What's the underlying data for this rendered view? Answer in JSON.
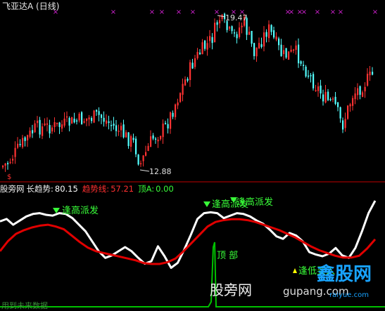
{
  "title": "飞亚达A (日线)",
  "price_chart": {
    "high_label": "19.47",
    "low_label": "12.88",
    "flag_label": "$"
  },
  "indicator_bar": {
    "source": "股旁网",
    "name": "长趋势:",
    "trend_value": "80.15",
    "trendline_label": "趋势线:",
    "trendline_value": "57.21",
    "top_label": "顶A:",
    "top_value": "0.00"
  },
  "annotations": {
    "sell_1": "逢高派发",
    "sell_2": "逢高派发",
    "sell_3": "逢高派发",
    "top": "顶 部",
    "buy": "逢低买入"
  },
  "watermarks": {
    "main": "股旁网",
    "url": "gupang.com",
    "logo": "鑫股网",
    "domain": "raiyue.com",
    "bottom": "用到未来数据"
  },
  "colors": {
    "background": "#000000",
    "up_candle": "#ff3232",
    "down_candle": "#54ffff",
    "divider": "#c00000",
    "long_trend": "#ffffff",
    "trend_line": "#e00000",
    "top_line": "#00c000",
    "signal_text": "#39ff39",
    "buy_marker": "#ffff00",
    "cross_marker": "#d020d0"
  },
  "chart_data": {
    "type": "line",
    "title": "飞亚达A (日线)",
    "ohlc_range": {
      "low": 12.88,
      "high": 19.47
    },
    "series": [
      {
        "name": "长趋势",
        "last_value": 80.15,
        "values": [
          70,
          73,
          66,
          71,
          76,
          79,
          80,
          78,
          77,
          80,
          79,
          74,
          66,
          58,
          46,
          34,
          26,
          29,
          34,
          39,
          34,
          26,
          19,
          22,
          40,
          28,
          14,
          20,
          36,
          54,
          73,
          80,
          81,
          80,
          74,
          77,
          80,
          79,
          76,
          71,
          67,
          60,
          52,
          49,
          56,
          53,
          46,
          33,
          30,
          28,
          31,
          38,
          29,
          26,
          38,
          58,
          80,
          95
        ]
      },
      {
        "name": "趋势线",
        "last_value": 57.21,
        "values": [
          44,
          55,
          63,
          67,
          70,
          72,
          73,
          71,
          68,
          61,
          54,
          48,
          44,
          42,
          40,
          38,
          36,
          34,
          31,
          30,
          30,
          32,
          36,
          44,
          53,
          62,
          71,
          76,
          78,
          79,
          79,
          78,
          76,
          73,
          70,
          67,
          63,
          59,
          54,
          49,
          45,
          42,
          39,
          37,
          37,
          39,
          47,
          57
        ]
      },
      {
        "name": "顶A",
        "last_value": 0.0,
        "values": [
          0,
          0,
          0,
          0,
          0,
          0,
          100,
          0,
          0,
          0,
          0,
          0,
          0
        ]
      }
    ]
  }
}
